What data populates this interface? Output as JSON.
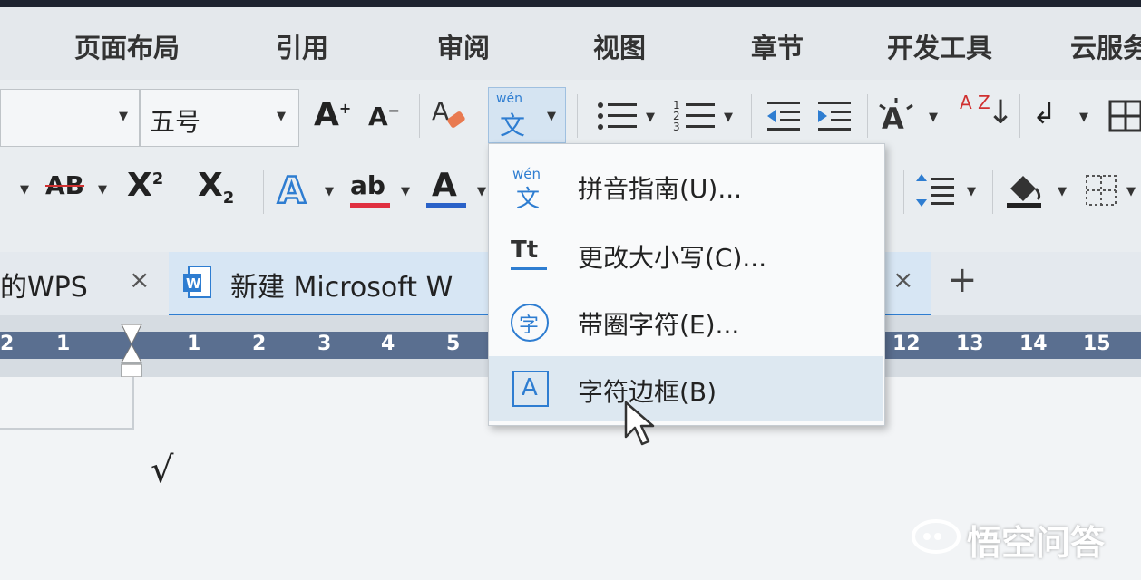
{
  "menubar": {
    "tabs": [
      "页面布局",
      "引用",
      "审阅",
      "视图",
      "章节",
      "开发工具",
      "云服务"
    ]
  },
  "toolbar": {
    "font_size_value": "五号",
    "increase_font_label": "A",
    "decrease_font_label": "A",
    "superscript_label": "X",
    "superscript_mark": "2",
    "subscript_label": "X",
    "subscript_mark": "2",
    "strikethrough_label": "AB",
    "font_color_label": "A",
    "highlight_label": "ab",
    "sort_label": "A Z",
    "pinyin_icon_top": "wén",
    "pinyin_icon_bottom": "文"
  },
  "tabs": {
    "first_tab_label": "的WPS",
    "active_tab_label": "新建 Microsoft W",
    "close_symbol": "×",
    "new_tab_symbol": "+"
  },
  "ruler": {
    "left_numbers": [
      "2",
      "1"
    ],
    "numbers": [
      "1",
      "2",
      "3",
      "4",
      "5"
    ],
    "right_numbers": [
      "12",
      "13",
      "14",
      "15"
    ]
  },
  "dropdown": {
    "items": [
      {
        "label": "拼音指南(U)...",
        "icon": "pinyin-guide-icon",
        "icon_top": "wén",
        "icon_bottom": "文"
      },
      {
        "label": "更改大小写(C)...",
        "icon": "change-case-icon",
        "icon_text": "Tt"
      },
      {
        "label": "带圈字符(E)...",
        "icon": "enclosed-char-icon",
        "icon_text": "字"
      },
      {
        "label": "字符边框(B)",
        "icon": "char-border-icon",
        "icon_text": "A"
      }
    ],
    "highlighted_index": 3
  },
  "document": {
    "checkmark": "√"
  },
  "watermark": {
    "text": "悟空问答"
  },
  "colors": {
    "accent_blue": "#2e7dd1",
    "ruler_band": "#5a6f90",
    "menu_highlight": "#dde8f1",
    "font_color_bar": "#2a62c8",
    "highlight_bar": "#e03040"
  }
}
